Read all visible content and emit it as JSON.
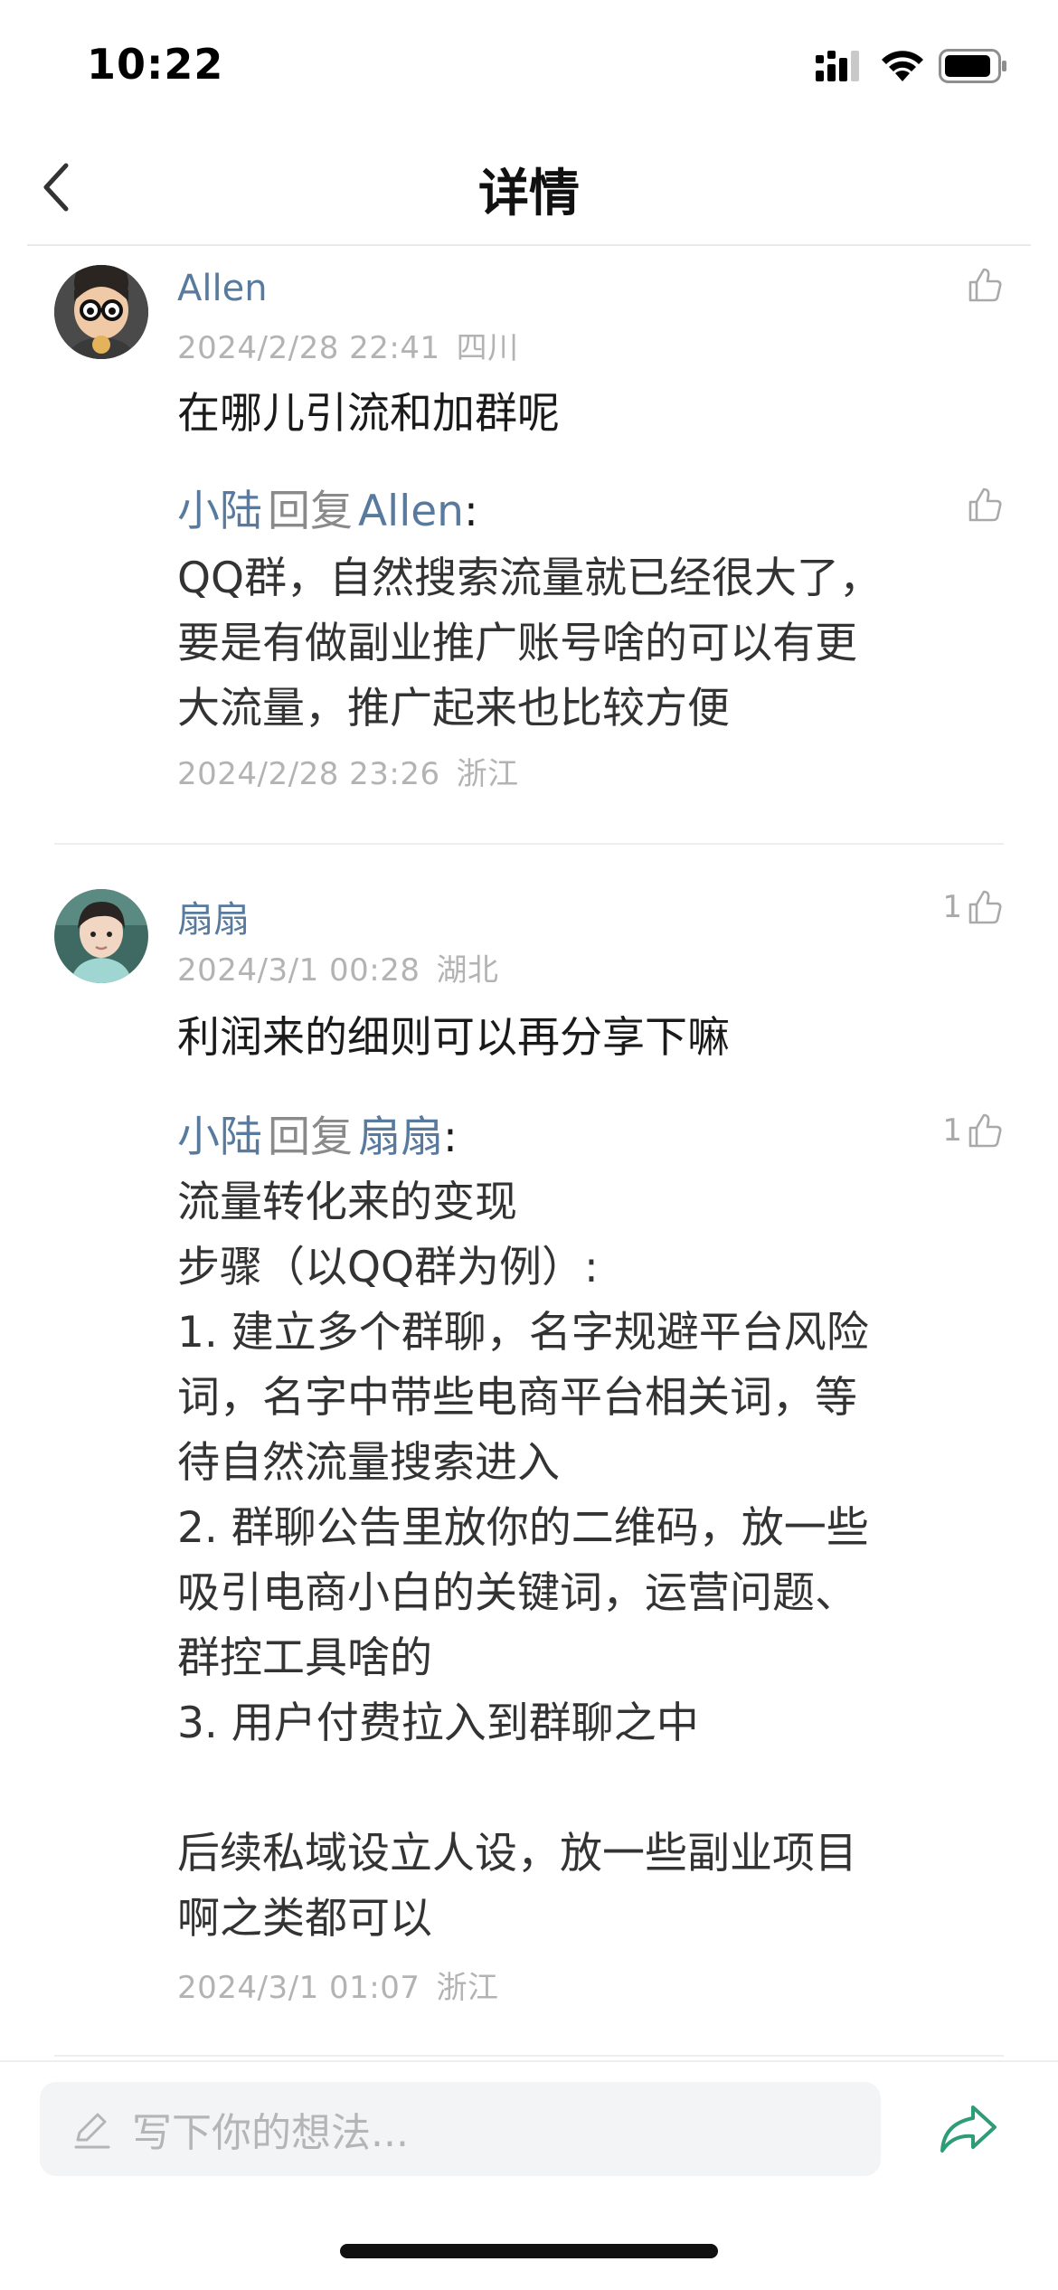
{
  "status_bar": {
    "time": "10:22"
  },
  "nav": {
    "title": "详情"
  },
  "comments": [
    {
      "author": "Allen",
      "date": "2024/2/28 22:41",
      "region": "四川",
      "text": "在哪儿引流和加群呢",
      "likes": "",
      "reply": {
        "from": "小陆",
        "verb": "回复",
        "to": "Allen",
        "text": "QQ群，自然搜索流量就已经很大了，\n要是有做副业推广账号啥的可以有更\n大流量，推广起来也比较方便",
        "date": "2024/2/28 23:26",
        "region": "浙江",
        "likes": ""
      }
    },
    {
      "author": "扇扇",
      "date": "2024/3/1 00:28",
      "region": "湖北",
      "text": "利润来的细则可以再分享下嘛",
      "likes": "1",
      "reply": {
        "from": "小陆",
        "verb": "回复",
        "to": "扇扇",
        "text": "流量转化来的变现\n步骤（以QQ群为例）:\n1. 建立多个群聊，名字规避平台风险\n词，名字中带些电商平台相关词，等\n待自然流量搜索进入\n2. 群聊公告里放你的二维码，放一些\n吸引电商小白的关键词，运营问题、\n群控工具啥的\n3. 用户付费拉入到群聊之中\n\n后续私域设立人设，放一些副业项目\n啊之类都可以",
        "date": "2024/3/1 01:07",
        "region": "浙江",
        "likes": "1"
      }
    }
  ],
  "input": {
    "placeholder": "写下你的想法..."
  },
  "colors": {
    "name_blue": "#587a9e",
    "share_green": "#2e9c77",
    "meta_gray": "#b3b3b3"
  }
}
